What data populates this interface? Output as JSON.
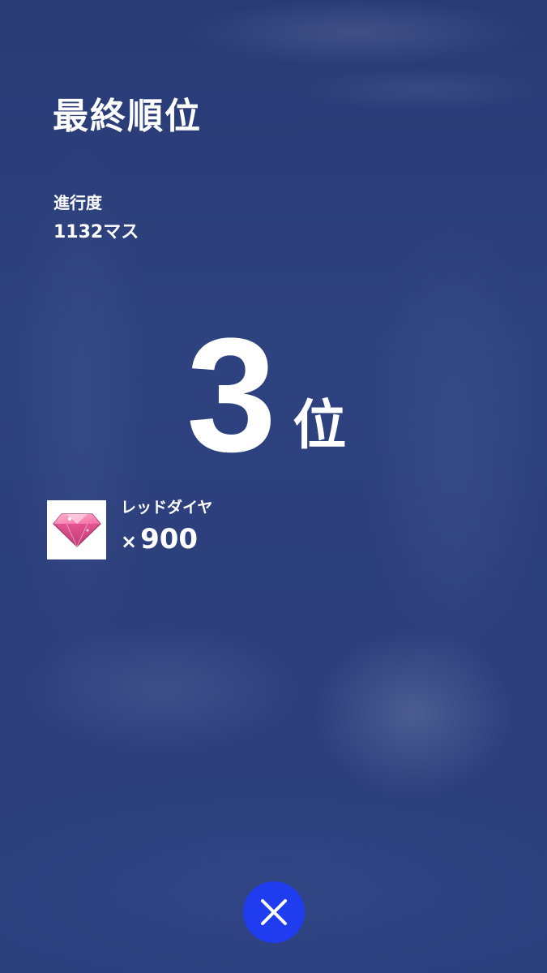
{
  "header": {
    "title": "最終順位"
  },
  "progress": {
    "label": "進行度",
    "value": "1132マス"
  },
  "rank": {
    "number": "3",
    "suffix": "位"
  },
  "reward": {
    "name": "レッドダイヤ",
    "times": "×",
    "quantity": "900",
    "icon": "red-diamond-icon"
  },
  "close": {
    "icon": "close-icon",
    "color": "#1f3dee"
  }
}
